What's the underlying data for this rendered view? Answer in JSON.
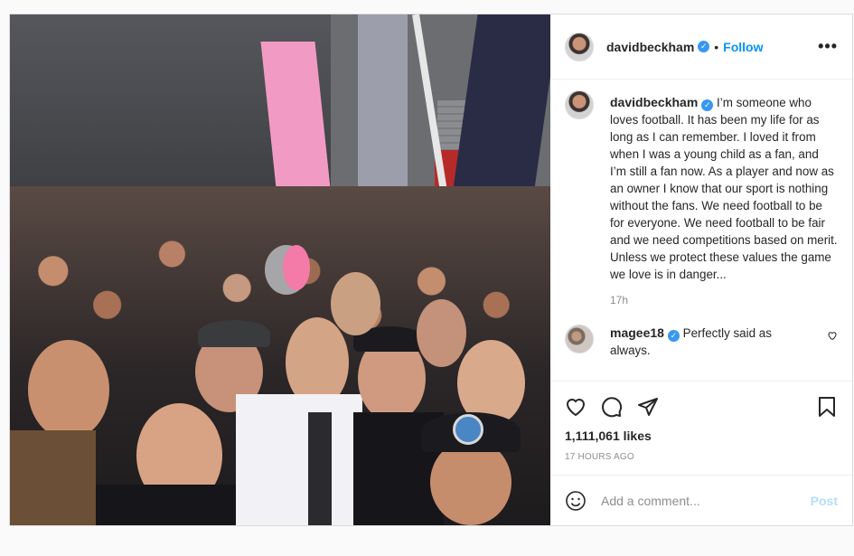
{
  "header": {
    "username": "davidbeckham",
    "separator": "•",
    "follow_label": "Follow",
    "more_label": "•••"
  },
  "caption": {
    "username": "davidbeckham",
    "text": "I’m someone who loves football. It has been my life for as long as I can remember. I loved it from when I was a young child as a fan, and I’m still a fan now. As a player and now as an owner I know that our sport is nothing without the fans. We need football to be for everyone. We need football to be fair and we need competitions based on merit. Unless we protect these values the game we love is in danger...",
    "time": "17h"
  },
  "comments": [
    {
      "username": "magee18",
      "text": "Perfectly said as always."
    }
  ],
  "actions": {
    "likes": "1,111,061 likes",
    "timestamp": "17 HOURS AGO"
  },
  "add_comment": {
    "placeholder": "Add a comment...",
    "post_label": "Post"
  },
  "icons": {
    "verified": "verified-badge-icon",
    "like": "heart-icon",
    "comment": "comment-bubble-icon",
    "share": "paper-plane-icon",
    "save": "bookmark-icon",
    "emoji": "smiley-icon",
    "comment_like": "heart-icon"
  },
  "colors": {
    "accent": "#0095f6",
    "verified": "#3897f0",
    "post_disabled": "#b2dffc",
    "muted": "#8e8e8e"
  }
}
